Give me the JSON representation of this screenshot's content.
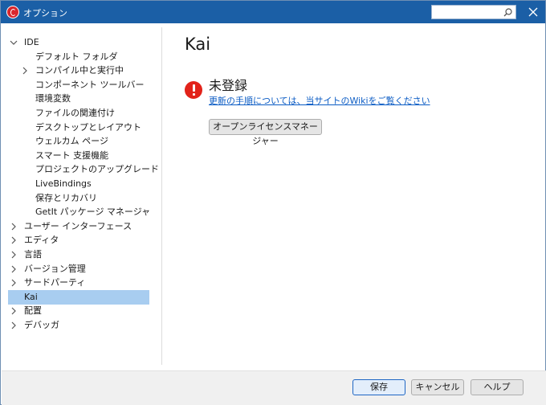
{
  "window": {
    "title": "オプション",
    "search_placeholder": "",
    "accent_color": "#1b5fa6"
  },
  "tree": {
    "items": [
      {
        "label": "IDE",
        "level": 0,
        "expanded": true
      },
      {
        "label": "デフォルト フォルダ",
        "level": 1
      },
      {
        "label": "コンパイル中と実行中",
        "level": 1,
        "collapsed": true
      },
      {
        "label": "コンポーネント ツールバー",
        "level": 1
      },
      {
        "label": "環境変数",
        "level": 1
      },
      {
        "label": "ファイルの関連付け",
        "level": 1
      },
      {
        "label": "デスクトップとレイアウト",
        "level": 1
      },
      {
        "label": "ウェルカム ページ",
        "level": 1
      },
      {
        "label": "スマート 支援機能",
        "level": 1
      },
      {
        "label": "プロジェクトのアップグレード",
        "level": 1
      },
      {
        "label": "LiveBindings",
        "level": 1
      },
      {
        "label": "保存とリカバリ",
        "level": 1
      },
      {
        "label": "GetIt パッケージ マネージャ",
        "level": 1
      },
      {
        "label": "ユーザー インターフェース",
        "level": 0,
        "collapsed": true
      },
      {
        "label": "エディタ",
        "level": 0,
        "collapsed": true
      },
      {
        "label": "言語",
        "level": 0,
        "collapsed": true
      },
      {
        "label": "バージョン管理",
        "level": 0,
        "collapsed": true
      },
      {
        "label": "サードパーティ",
        "level": 0,
        "collapsed": true
      },
      {
        "label": "Kai",
        "level": 0,
        "selected": true
      },
      {
        "label": "配置",
        "level": 0,
        "collapsed": true
      },
      {
        "label": "デバッガ",
        "level": 0,
        "collapsed": true
      }
    ],
    "selected_color": "#a8cdf0"
  },
  "main": {
    "page_title": "Kai",
    "status_title": "未登録",
    "status_link": "更新の手順については、当サイトのWikiをご覧ください",
    "license_button": "オープンライセンスマネージャー",
    "error_color": "#e2231a"
  },
  "footer": {
    "save": "保存",
    "cancel": "キャンセル",
    "help": "ヘルプ"
  }
}
